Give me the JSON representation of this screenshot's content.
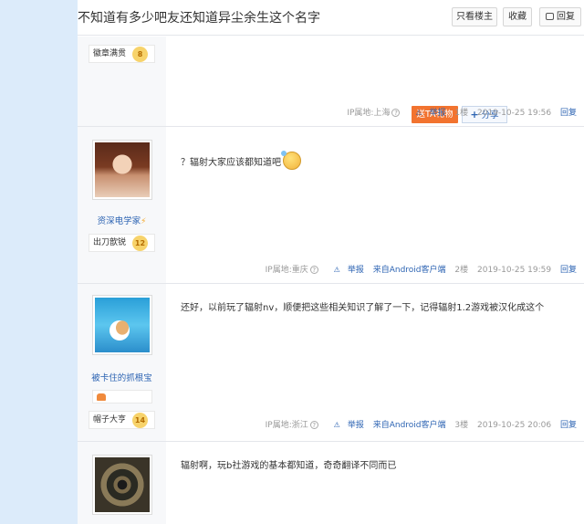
{
  "thread": {
    "title": "不知道有多少吧友还知道异尘余生这个名字",
    "buttons": {
      "only_op": "只看楼主",
      "favorite": "收藏",
      "reply": "回复"
    }
  },
  "actions": {
    "gift": "送TA礼物",
    "share": "分享"
  },
  "posts": [
    {
      "badge": {
        "name": "徽章满贯",
        "level": "8"
      },
      "footer": {
        "ip": "IP属地:上海",
        "report": "举报",
        "floor": "1楼",
        "time": "2019-10-25 19:56",
        "reply": "回复"
      }
    },
    {
      "user": {
        "name": "资深电学家",
        "badge_name": "出刀歆锐",
        "level": "12"
      },
      "content": "？辐射大家应该都知道吧",
      "footer": {
        "ip": "IP属地:重庆",
        "report": "举报",
        "client": "来自Android客户端",
        "floor": "2楼",
        "time": "2019-10-25 19:59",
        "reply": "回复"
      }
    },
    {
      "user": {
        "name": "被卡住的抓根宝",
        "badge_name": "帽子大亨",
        "level": "14"
      },
      "content": "还好，以前玩了辐射nv，顺便把这些相关知识了解了一下，记得辐射1.2游戏被汉化成这个",
      "footer": {
        "ip": "IP属地:浙江",
        "report": "举报",
        "client": "来自Android客户端",
        "floor": "3楼",
        "time": "2019-10-25 20:06",
        "reply": "回复"
      }
    },
    {
      "content": "辐射啊，玩b社游戏的基本都知道，奇奇翻译不同而已"
    }
  ],
  "icons": [
    "report-icon",
    "question-icon",
    "lightning-icon",
    "emoji-sweat-icon",
    "plus-icon",
    "reply-icon"
  ]
}
